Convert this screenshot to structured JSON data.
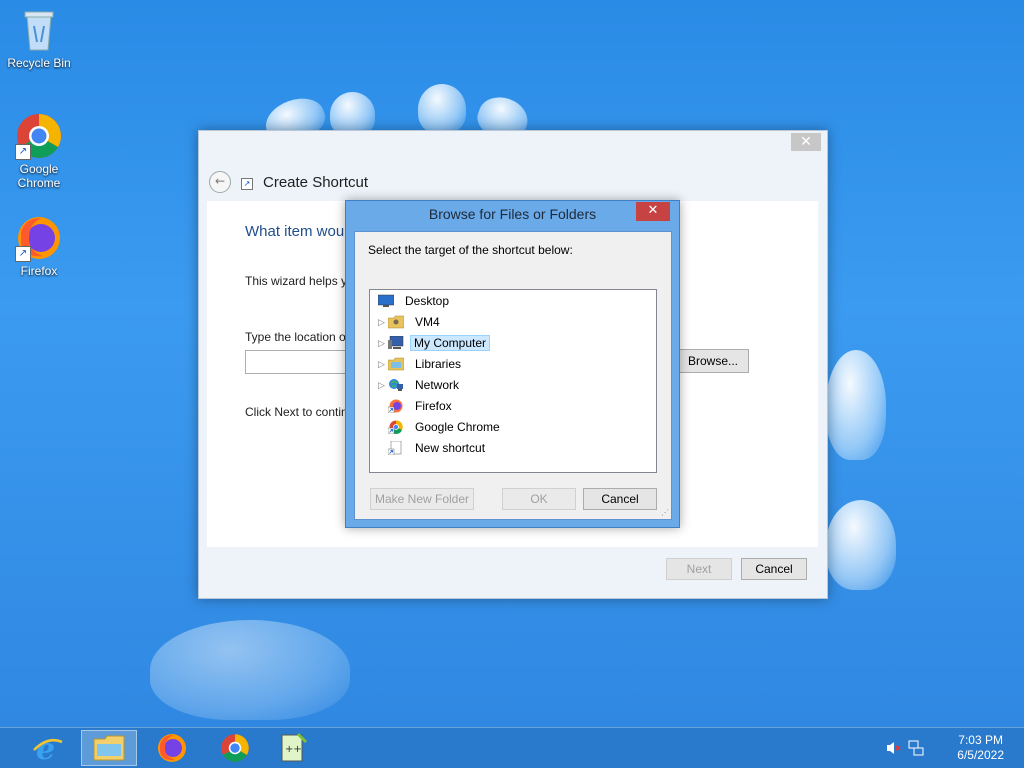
{
  "desktop": {
    "icons": [
      {
        "label": "Recycle Bin"
      },
      {
        "label": "Google Chrome"
      },
      {
        "label": "Firefox"
      }
    ]
  },
  "wizard": {
    "title": "Create Shortcut",
    "question": "What item wou",
    "description": "This wizard helps y                                                                              s, computers, or Internet addresses.",
    "location_label": "Type the location o",
    "browse_label": "Browse...",
    "next_hint": "Click Next to contin",
    "next_label": "Next",
    "cancel_label": "Cancel"
  },
  "browse_dialog": {
    "title": "Browse for Files or Folders",
    "instruction": "Select the target of the shortcut below:",
    "tree": [
      {
        "label": "Desktop",
        "icon": "desktop-icon",
        "expandable": false,
        "selected": false,
        "indent": 0
      },
      {
        "label": "VM4",
        "icon": "user-folder-icon",
        "expandable": true,
        "selected": false,
        "indent": 1
      },
      {
        "label": "My Computer",
        "icon": "computer-icon",
        "expandable": true,
        "selected": true,
        "indent": 1
      },
      {
        "label": "Libraries",
        "icon": "libraries-icon",
        "expandable": true,
        "selected": false,
        "indent": 1
      },
      {
        "label": "Network",
        "icon": "network-icon",
        "expandable": true,
        "selected": false,
        "indent": 1
      },
      {
        "label": "Firefox",
        "icon": "firefox-shortcut-icon",
        "expandable": false,
        "selected": false,
        "indent": 1
      },
      {
        "label": "Google Chrome",
        "icon": "chrome-shortcut-icon",
        "expandable": false,
        "selected": false,
        "indent": 1
      },
      {
        "label": "New shortcut",
        "icon": "shortcut-file-icon",
        "expandable": false,
        "selected": false,
        "indent": 1
      }
    ],
    "make_new_folder_label": "Make New Folder",
    "ok_label": "OK",
    "cancel_label": "Cancel"
  },
  "taskbar": {
    "items": [
      {
        "icon": "internet-explorer-icon",
        "active": false
      },
      {
        "icon": "file-explorer-icon",
        "active": true
      },
      {
        "icon": "firefox-icon",
        "active": false
      },
      {
        "icon": "chrome-icon",
        "active": false
      },
      {
        "icon": "notepad-plus-plus-icon",
        "active": false
      }
    ],
    "time": "7:03 PM",
    "date": "6/5/2022"
  }
}
